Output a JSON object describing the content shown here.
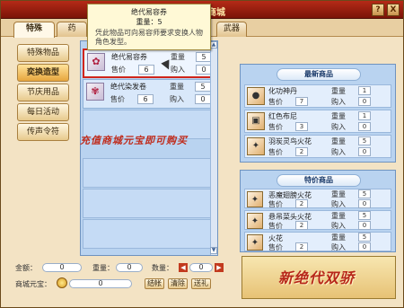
{
  "window": {
    "title_suffix": "商城",
    "help_label": "?",
    "close_label": "X"
  },
  "tabs": [
    {
      "label": "特殊"
    },
    {
      "label": "药"
    },
    {
      "label": "武器"
    }
  ],
  "sidebar": {
    "items": [
      {
        "label": "特殊物品"
      },
      {
        "label": "奕换造型"
      },
      {
        "label": "节庆用品"
      },
      {
        "label": "每日活动"
      },
      {
        "label": "传声令符"
      }
    ]
  },
  "tooltip": {
    "title": "绝代易容券",
    "qty": "重量：5",
    "desc": "凭此物品可向易容师要求变换人物角色发型。"
  },
  "items": [
    {
      "name": "绝代易容券",
      "weight_label": "重量",
      "weight": "5",
      "price_label": "售价",
      "price": "6",
      "buy_label": "购入",
      "buy": "0"
    },
    {
      "name": "绝代染发卷",
      "weight_label": "重量",
      "weight": "5",
      "price_label": "售价",
      "price": "6",
      "buy_label": "购入",
      "buy": "0"
    }
  ],
  "promo": "充值商城元宝即可购买",
  "new_items": {
    "header": "最新商品",
    "rows": [
      {
        "name": "化功神丹",
        "weight_label": "重量",
        "weight": "1",
        "price_label": "售价",
        "price": "7",
        "buy_label": "购入",
        "buy": "0"
      },
      {
        "name": "红色布尼",
        "weight_label": "重量",
        "weight": "1",
        "price_label": "售价",
        "price": "3",
        "buy_label": "购入",
        "buy": "0"
      },
      {
        "name": "羽炭灵鸟火花",
        "weight_label": "重量",
        "weight": "5",
        "price_label": "售价",
        "price": "2",
        "buy_label": "购入",
        "buy": "0"
      }
    ]
  },
  "special_items": {
    "header": "特价商品",
    "rows": [
      {
        "name": "恶魔翅膀火花",
        "weight_label": "重量",
        "weight": "5",
        "price_label": "售价",
        "price": "2",
        "buy_label": "购入",
        "buy": "0"
      },
      {
        "name": "悬吊菜头火花",
        "weight_label": "重量",
        "weight": "5",
        "price_label": "售价",
        "price": "2",
        "buy_label": "购入",
        "buy": "0"
      },
      {
        "name": "火花",
        "weight_label": "重量",
        "weight": "5",
        "price_label": "售价",
        "price": "2",
        "buy_label": "购入",
        "buy": "0"
      }
    ]
  },
  "bottom": {
    "amount_label": "金额：",
    "amount": "0",
    "weight_label": "重量：",
    "weight": "0",
    "quantity_label": "数量：",
    "quantity": "0",
    "ingot_label": "商城元宝：",
    "ingot": "0",
    "checkout": "结帐",
    "clear": "清除",
    "gift": "送礼"
  },
  "banner": {
    "text": "新绝代双骄"
  }
}
